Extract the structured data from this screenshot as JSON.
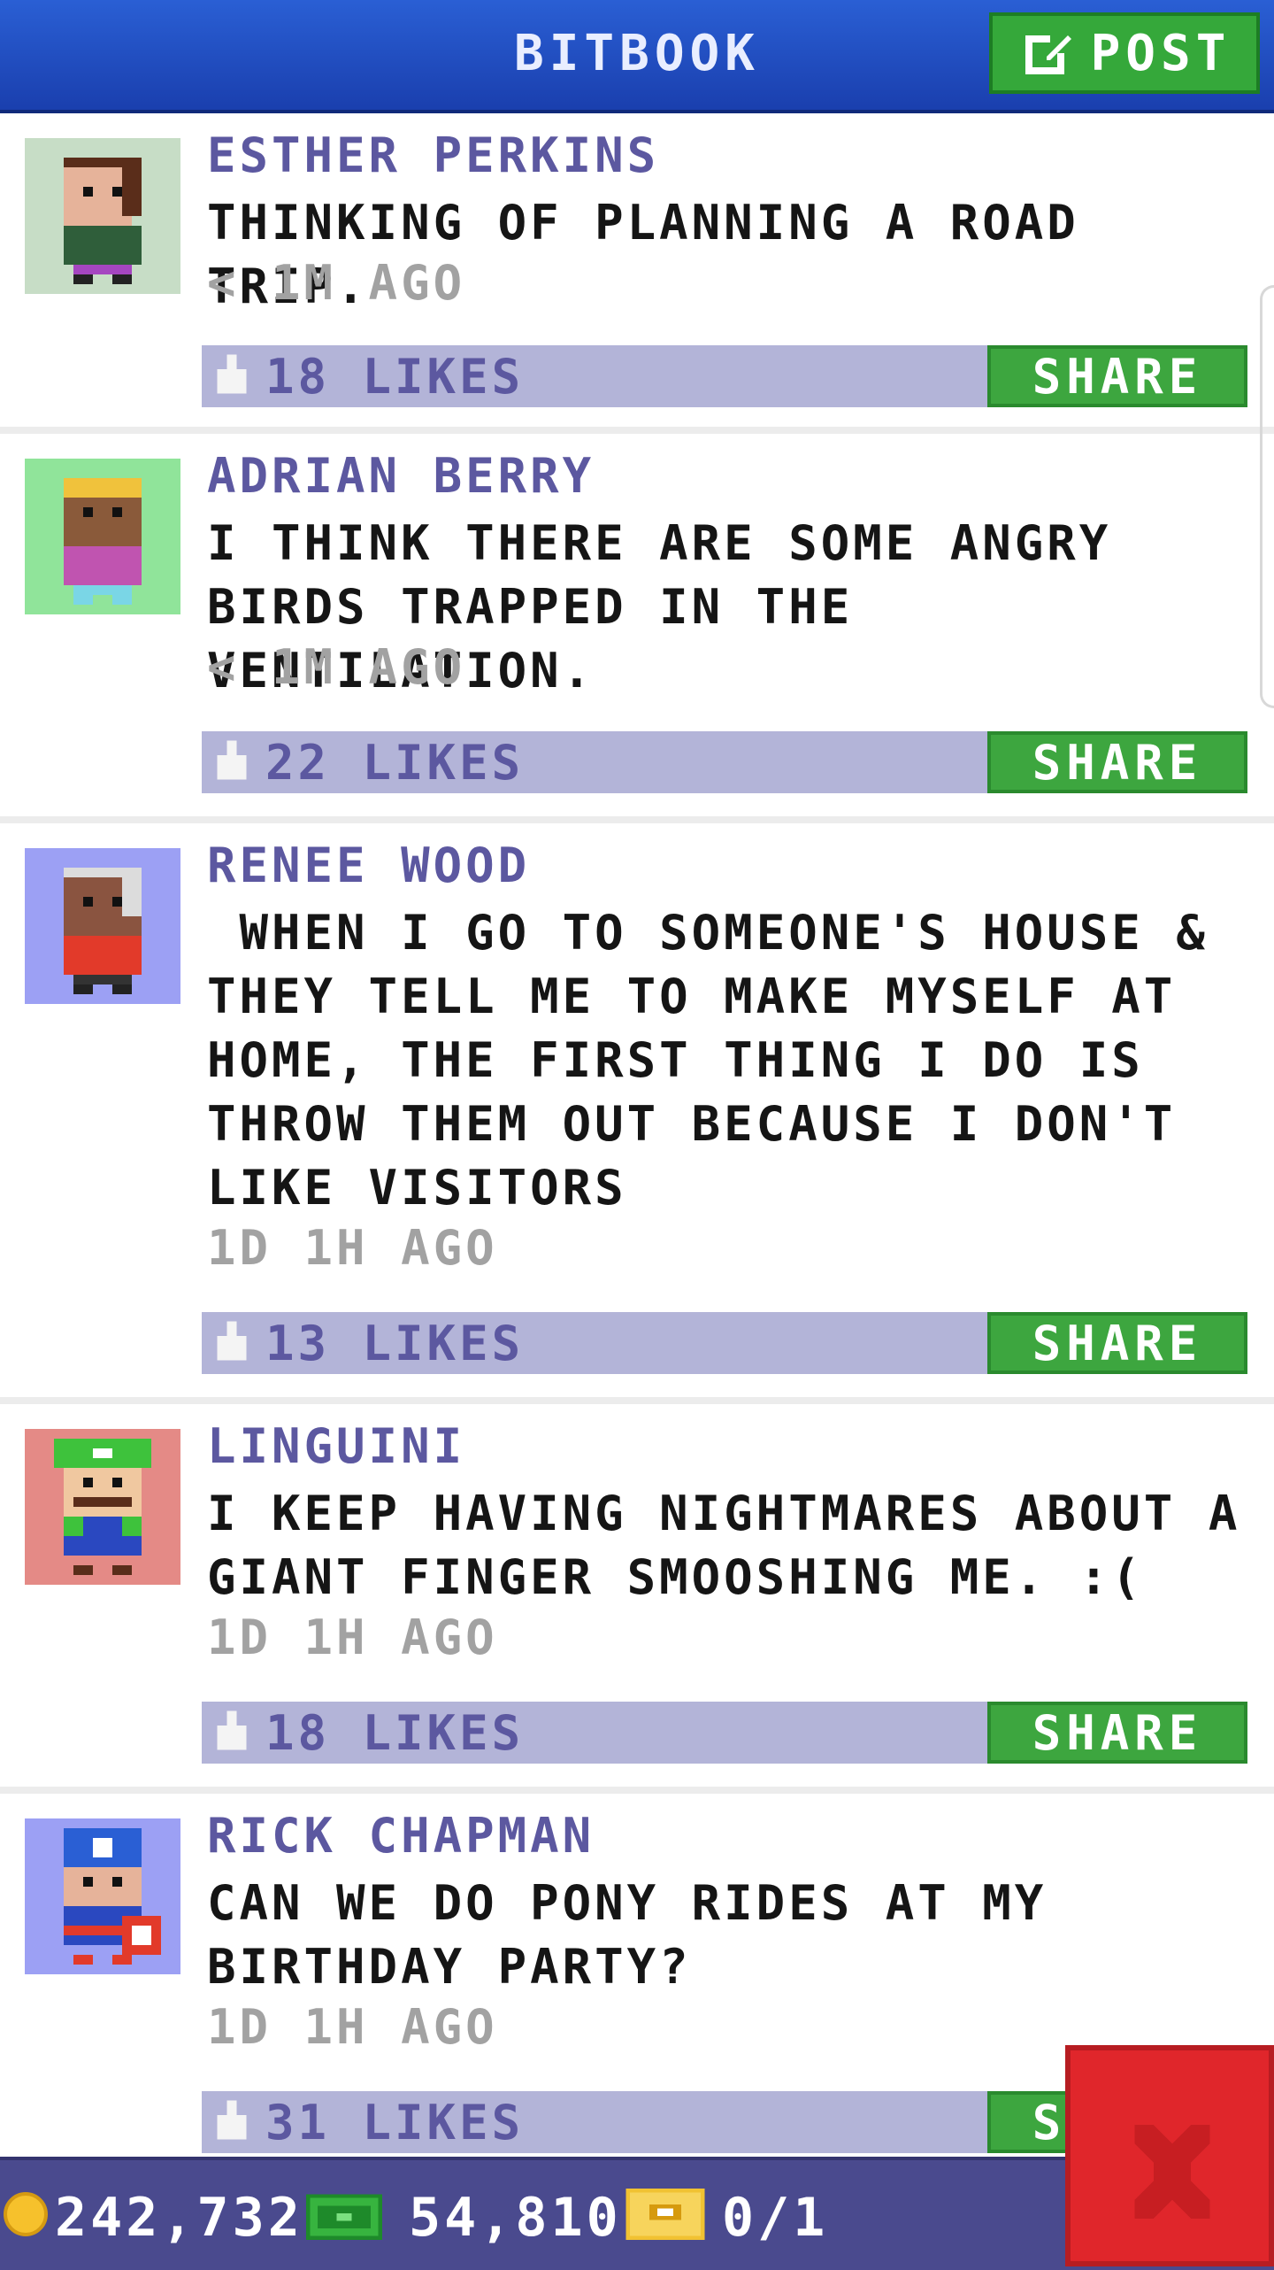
{
  "header": {
    "title": "BITBOOK",
    "post_label": "POST"
  },
  "posts": [
    {
      "name": "ESTHER PERKINS",
      "message": "THINKING OF PLANNING A ROAD TRIP.",
      "time": "< 1M AGO",
      "likes": "18 LIKES",
      "share": "SHARE"
    },
    {
      "name": "ADRIAN BERRY",
      "message": "I THINK THERE ARE SOME ANGRY BIRDS TRAPPED IN THE VENTILATION.",
      "time": "< 1M AGO",
      "likes": "22 LIKES",
      "share": "SHARE"
    },
    {
      "name": "RENEE WOOD",
      "message": " WHEN I GO TO SOMEONE'S HOUSE & THEY TELL ME TO MAKE MYSELF AT HOME, THE FIRST THING I DO IS THROW THEM OUT BECAUSE I DON'T LIKE VISITORS",
      "time": "1D 1H AGO",
      "likes": "13 LIKES",
      "share": "SHARE"
    },
    {
      "name": "LINGUINI",
      "message": "I KEEP HAVING NIGHTMARES ABOUT A GIANT FINGER SMOOSHING ME. :(",
      "time": "1D 1H AGO",
      "likes": "18 LIKES",
      "share": "SHARE"
    },
    {
      "name": "RICK CHAPMAN",
      "message": "CAN WE DO PONY RIDES AT MY BIRTHDAY PARTY?",
      "time": "1D 1H AGO",
      "likes": "31 LIKES",
      "share": "SHARE"
    }
  ],
  "footer": {
    "coins": "242,732",
    "bux": "54,810",
    "tickets": "0/1"
  },
  "colors": {
    "header_blue": "#1a3fae",
    "accent_green": "#3da63f",
    "like_bar": "#b3b4d8",
    "name_purple": "#5c58a0",
    "footer": "#4a4a8e",
    "close_red": "#e0262b"
  },
  "icons": {
    "post": "edit-icon",
    "like": "thumbs-up-icon",
    "coin": "coin-icon",
    "bux": "bux-icon",
    "ticket": "ticket-icon",
    "close": "close-icon"
  }
}
